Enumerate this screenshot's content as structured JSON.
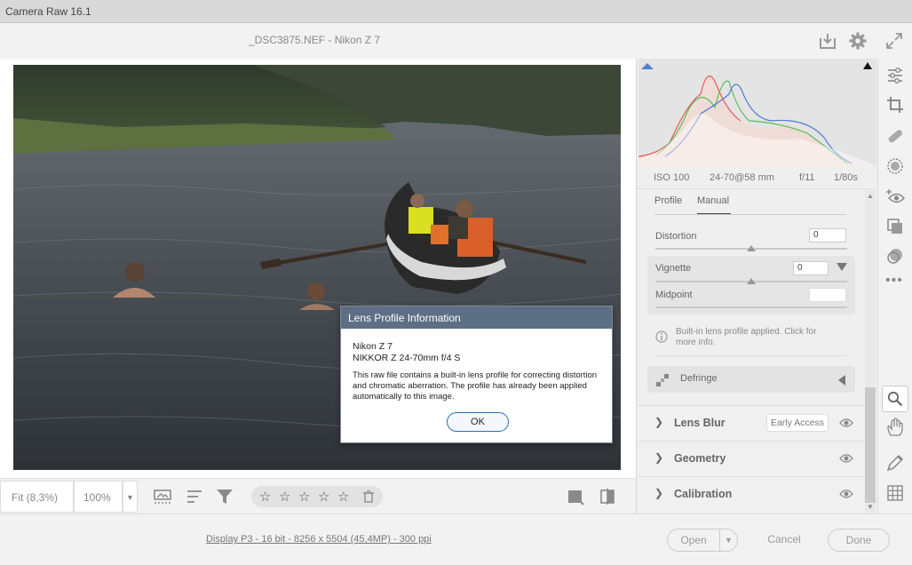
{
  "app": {
    "title": "Camera Raw 16.1"
  },
  "header": {
    "file_title": "_DSC3875.NEF  -  Nikon Z 7"
  },
  "dialog": {
    "title": "Lens Profile Information",
    "camera": "Nikon Z 7",
    "lens": "NIKKOR Z 24-70mm f/4 S",
    "message": "This raw file contains a built-in lens profile for correcting distortion and chromatic aberration. The profile has already been applied automatically to this image.",
    "ok_label": "OK"
  },
  "toolbar": {
    "zoom_fit": "Fit (8,3%)",
    "zoom_100": "100%",
    "stars": [
      "☆",
      "☆",
      "☆",
      "☆",
      "☆"
    ]
  },
  "footer": {
    "info": "Display P3 - 16 bit - 8256 x 5504 (45,4MP) - 300 ppi",
    "open_label": "Open",
    "cancel_label": "Cancel",
    "done_label": "Done"
  },
  "exif": {
    "iso": "ISO 100",
    "focal": "24-70@58 mm",
    "aperture": "f/11",
    "shutter": "1/80s"
  },
  "optics": {
    "tabs": [
      "Profile",
      "Manual"
    ],
    "active_tab": "Manual",
    "distortion_label": "Distortion",
    "distortion_value": "0",
    "distortion_level": 0.5,
    "vignette_label": "Vignette",
    "vignette_value": "0",
    "vignette_level": 0.5,
    "midpoint_label": "Midpoint",
    "midpoint_value": "",
    "note": "Built-in lens profile applied.  Click for more info.",
    "defringe_label": "Defringe"
  },
  "sections": [
    {
      "title": "Lens Blur",
      "badge": "Early Access"
    },
    {
      "title": "Geometry"
    },
    {
      "title": "Calibration"
    }
  ],
  "colors": {
    "dialog_title_bg": "#5d6f84",
    "ok_border": "#2a6fb5"
  }
}
